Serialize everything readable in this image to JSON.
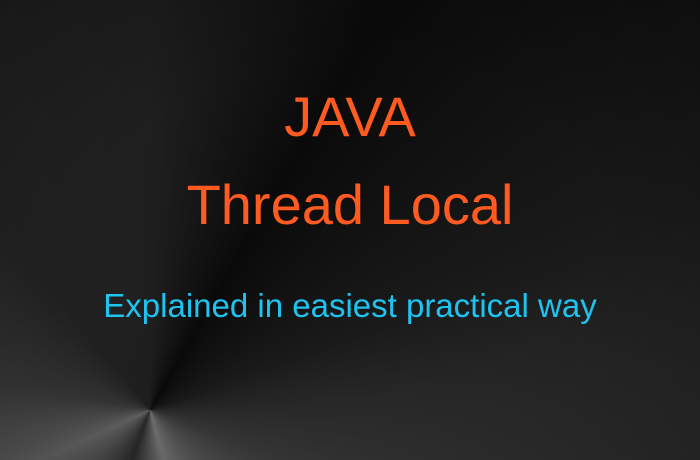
{
  "title": {
    "line1": "JAVA",
    "line2": "Thread Local"
  },
  "subtitle": "Explained in easiest practical way",
  "colors": {
    "title": "#ff5a1f",
    "subtitle": "#1ec3f0",
    "background": "#2a2a2a"
  }
}
